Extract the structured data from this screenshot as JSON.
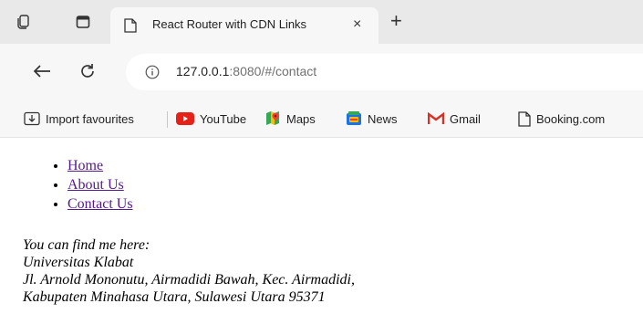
{
  "browser": {
    "tab": {
      "title": "React Router with CDN Links",
      "close_glyph": "×"
    },
    "new_tab_glyph": "+",
    "url": {
      "host": "127.0.0.1",
      "rest": ":8080/#/contact"
    },
    "bookmarks": [
      {
        "label": "Import favourites",
        "icon": "import-icon"
      },
      {
        "label": "YouTube",
        "icon": "youtube-icon"
      },
      {
        "label": "Maps",
        "icon": "maps-icon"
      },
      {
        "label": "News",
        "icon": "news-icon"
      },
      {
        "label": "Gmail",
        "icon": "gmail-icon"
      },
      {
        "label": "Booking.com",
        "icon": "document-icon"
      }
    ],
    "colors": {
      "tabbar": "#e9e9e9",
      "toolbar": "#f7f7f7",
      "youtube": "#e62117",
      "gmail": "#d93025",
      "visited_link": "#551a8b"
    }
  },
  "page": {
    "nav": [
      {
        "label": "Home"
      },
      {
        "label": "About Us"
      },
      {
        "label": "Contact Us"
      }
    ],
    "address": {
      "intro": "You can find me here:",
      "line1": "Universitas Klabat",
      "line2": "Jl. Arnold Mononutu, Airmadidi Bawah, Kec. Airmadidi,",
      "line3": "Kabupaten Minahasa Utara, Sulawesi Utara 95371"
    }
  }
}
